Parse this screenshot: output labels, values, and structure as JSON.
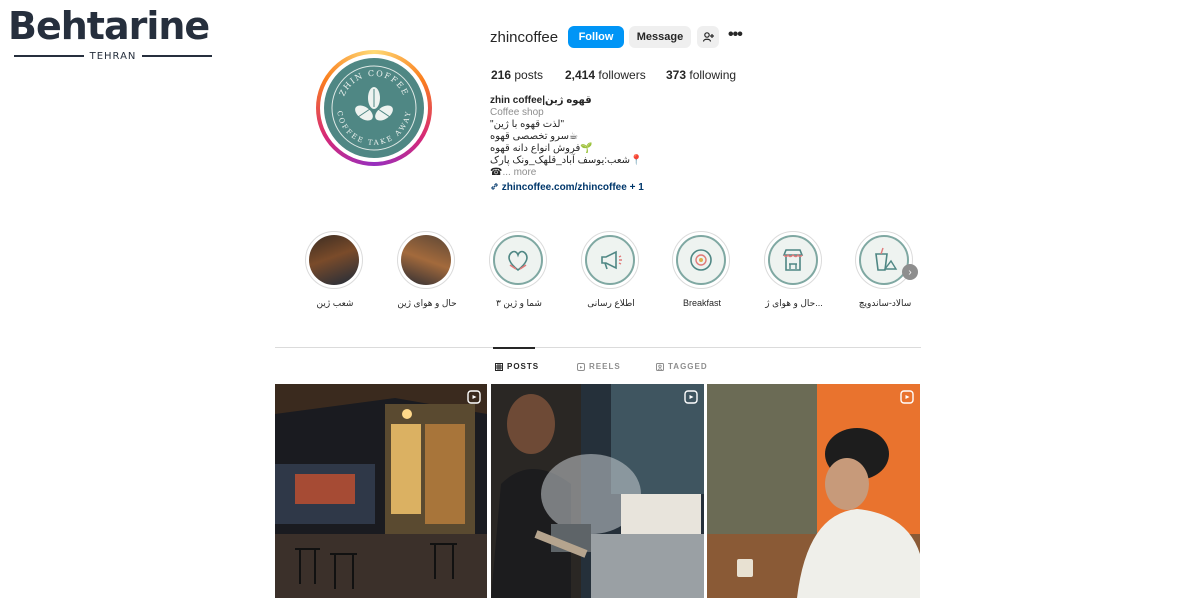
{
  "watermark": {
    "title": "Behtarine",
    "subtitle": "TEHRAN"
  },
  "profile": {
    "username": "zhincoffee",
    "logo_text_top": "ZHIN COFFEE",
    "logo_text_bottom": "COFFEE TAKE AWAY",
    "follow_label": "Follow",
    "message_label": "Message",
    "add_user_icon": "add-user-icon",
    "more_label": "•••"
  },
  "stats": {
    "posts_count": "216",
    "posts_label": "posts",
    "followers_count": "2,414",
    "followers_label": "followers",
    "following_count": "373",
    "following_label": "following"
  },
  "bio": {
    "name": "zhin coffee|قهوه ژین",
    "category": "Coffee shop",
    "line1": "\"لذت قهوه با ژین\"",
    "line2": "سرو تخصصی قهوه☕",
    "line3": "فروش انواع دانه قهوه🌱",
    "line4": "شعب:یوسف آباد_قلهک_ونک پارک📍",
    "line5_icon": "☎",
    "line5_more": "... more",
    "link": "zhincoffee.com/zhincoffee + 1"
  },
  "highlights": [
    {
      "label": "شعب ژین",
      "kind": "photo1"
    },
    {
      "label": "حال و هوای ژین",
      "kind": "photo2"
    },
    {
      "label": "شما و ژین ۳",
      "kind": "heart"
    },
    {
      "label": "اطلاع رسانی",
      "kind": "megaphone"
    },
    {
      "label": "Breakfast",
      "kind": "plate"
    },
    {
      "label": "حال و هوای ژ...",
      "kind": "shop"
    },
    {
      "label": "سالاد-ساندویچ",
      "kind": "drink"
    }
  ],
  "tabs": {
    "posts": "POSTS",
    "reels": "REELS",
    "tagged": "TAGGED"
  },
  "colors": {
    "follow": "#0095f6",
    "logo_bg": "#4f8784",
    "link": "#00376b",
    "accent_ring": "#d62976"
  }
}
